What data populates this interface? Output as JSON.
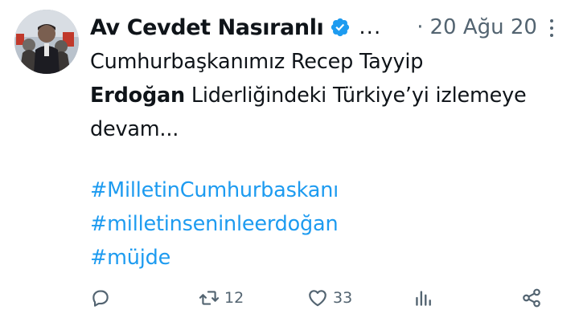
{
  "tweet": {
    "author_name": "Av Cevdet Nasıranlı",
    "overflow_name": "...",
    "separator": "·",
    "date": "20 Ağu 20",
    "body_lines": [
      [
        {
          "text": "Cumhurbaşkanımız Recep Tayyip",
          "bold": false
        }
      ],
      [
        {
          "text": "Erdoğan",
          "bold": true
        },
        {
          "text": " Liderliğindeki Türkiye’yi izlemeye",
          "bold": false
        }
      ],
      [
        {
          "text": "devam...",
          "bold": false
        }
      ]
    ],
    "hashtags": [
      "#MilletinCumhurbaskanı",
      "#milletinseninleerdoğan",
      "#müjde"
    ],
    "actions": {
      "reply_count": "",
      "retweet_count": "12",
      "like_count": "33",
      "views_count": ""
    }
  },
  "colors": {
    "link": "#1d9bf0",
    "secondary_text": "#536471",
    "verified_badge": "#1d9bf0"
  },
  "icons": [
    "verified-badge-icon",
    "more-options-icon",
    "reply-icon",
    "retweet-icon",
    "like-icon",
    "views-icon",
    "share-icon"
  ]
}
